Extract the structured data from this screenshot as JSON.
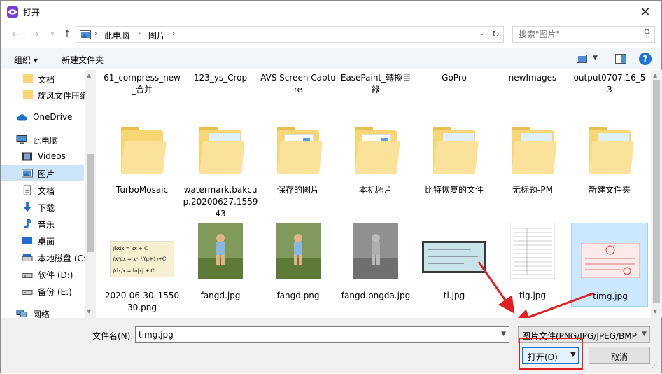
{
  "window": {
    "title": "打开",
    "accent": "#0078d7"
  },
  "address": {
    "segments": [
      "此电脑",
      "图片"
    ],
    "separator": "›"
  },
  "search": {
    "placeholder": "搜索\"图片\""
  },
  "toolbar": {
    "organize_label": "组织 ▾",
    "new_folder_label": "新建文件夹",
    "help_label": "?"
  },
  "sidebar": {
    "items": [
      {
        "label": "文档",
        "icon": "folder-icon"
      },
      {
        "label": "旋风文件压缩",
        "icon": "folder-icon"
      },
      {
        "label": "OneDrive",
        "icon": "cloud-icon"
      },
      {
        "label": "此电脑",
        "icon": "computer-icon"
      },
      {
        "label": "Videos",
        "icon": "video-icon"
      },
      {
        "label": "图片",
        "icon": "pictures-icon",
        "selected": true
      },
      {
        "label": "文档",
        "icon": "document-icon"
      },
      {
        "label": "下载",
        "icon": "download-icon"
      },
      {
        "label": "音乐",
        "icon": "music-icon"
      },
      {
        "label": "桌面",
        "icon": "desktop-icon"
      },
      {
        "label": "本地磁盘 (C:)",
        "icon": "drive-icon"
      },
      {
        "label": "软件 (D:)",
        "icon": "drive-icon"
      },
      {
        "label": "备份 (E:)",
        "icon": "drive-icon"
      },
      {
        "label": "网络",
        "icon": "network-icon"
      }
    ]
  },
  "files": {
    "row1": [
      {
        "name": "61_compress_new_合并",
        "kind": "folder-photo"
      },
      {
        "name": "123_ys_Crop",
        "kind": "folder"
      },
      {
        "name": "AVS Screen Capture",
        "kind": "folder"
      },
      {
        "name": "EasePaint_轉換目錄",
        "kind": "folder-photo"
      },
      {
        "name": "GoPro",
        "kind": "folder"
      },
      {
        "name": "newImages",
        "kind": "folder"
      },
      {
        "name": "output0707.16_53",
        "kind": "folder-photo"
      }
    ],
    "row2": [
      {
        "name": "TurboMosaic",
        "kind": "folder"
      },
      {
        "name": "watermark.bakcup.20200627.155943",
        "kind": "folder-photo"
      },
      {
        "name": "保存的图片",
        "kind": "folder-doc"
      },
      {
        "name": "本机照片",
        "kind": "folder-doc"
      },
      {
        "name": "比特恢复的文件",
        "kind": "folder-photo"
      },
      {
        "name": "无标题-PM",
        "kind": "folder-photo"
      },
      {
        "name": "新建文件夹",
        "kind": "folder-photo"
      }
    ],
    "row3": [
      {
        "name": "2020-06-30_155030.png",
        "kind": "image-formula"
      },
      {
        "name": "fangd.jpg",
        "kind": "image-girl"
      },
      {
        "name": "fangd.png",
        "kind": "image-girl"
      },
      {
        "name": "fangd.pngda.jpg",
        "kind": "image-girl-gray"
      },
      {
        "name": "ti.jpg",
        "kind": "image-ticket"
      },
      {
        "name": "tig.jpg",
        "kind": "image-form"
      },
      {
        "name": "timg.jpg",
        "kind": "image-invoice",
        "selected": true
      }
    ]
  },
  "footer": {
    "filename_label": "文件名(N):",
    "filename_value": "timg.jpg",
    "filetype_value": "图片文件(PNG/JPG/JPEG/BMP)",
    "open_label": "打开(O)",
    "cancel_label": "取消"
  },
  "colors": {
    "selection": "#cce8ff",
    "highlight_red": "#e02020",
    "folder": "#f7d674"
  }
}
